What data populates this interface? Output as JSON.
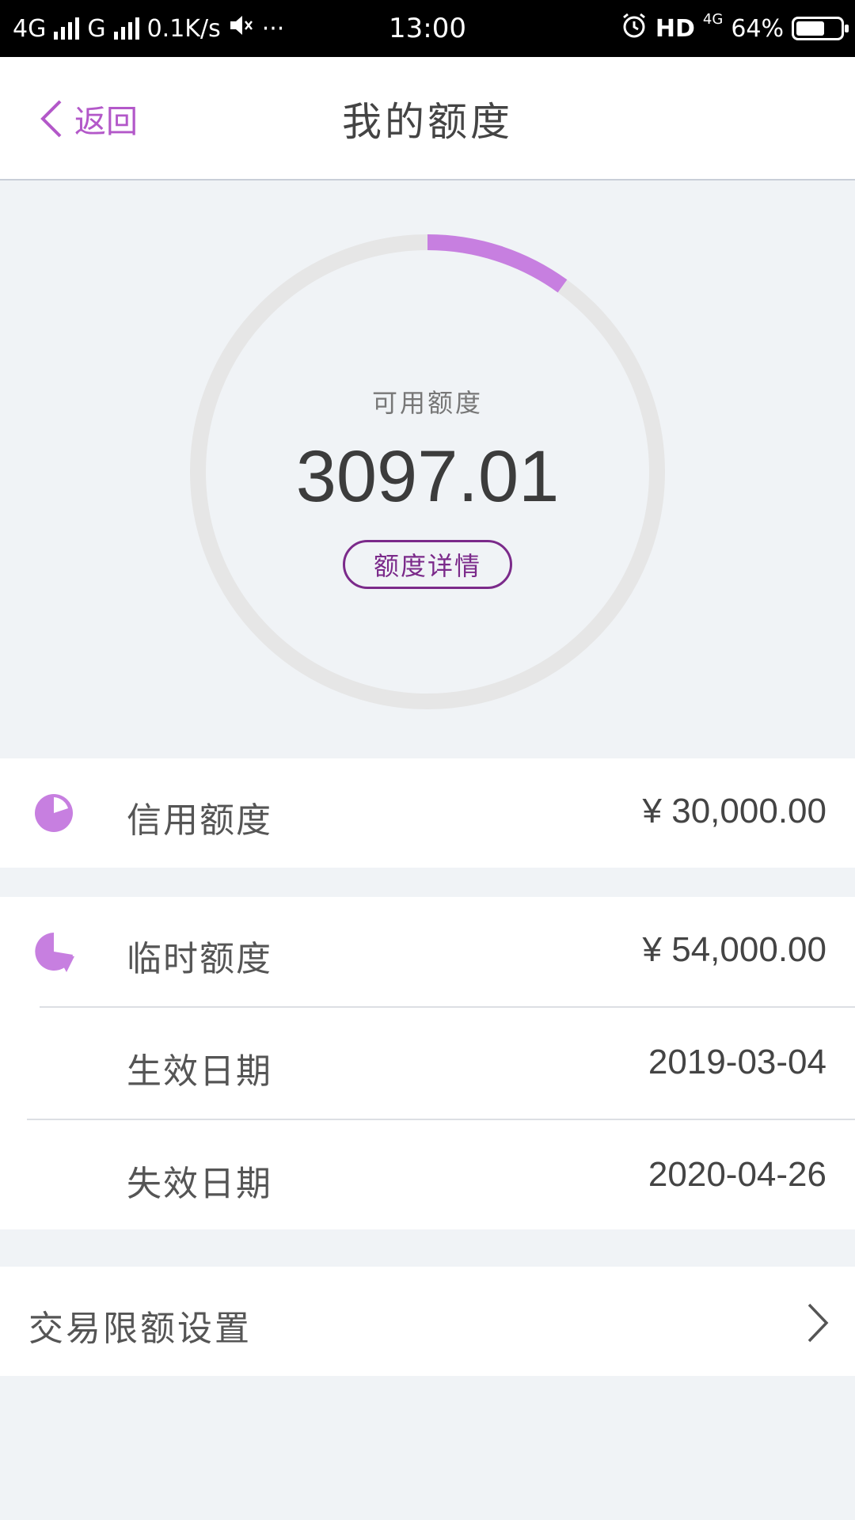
{
  "status_bar": {
    "network1": "4G",
    "network2": "G",
    "speed": "0.1K/s",
    "time": "13:00",
    "hd": "HD",
    "net_small": "4G",
    "battery": "64%",
    "battery_level": 0.64
  },
  "nav": {
    "back_label": "返回",
    "title": "我的额度"
  },
  "gauge": {
    "label": "可用额度",
    "value": "3097.01",
    "detail_button": "额度详情",
    "used_fraction": 0.1,
    "accent_color": "#c77fe0",
    "track_color": "#e6e6e6"
  },
  "credit": {
    "label": "信用额度",
    "value": "¥ 30,000.00",
    "icon": "pie-chart-icon"
  },
  "temp": {
    "label": "临时额度",
    "value": "¥ 54,000.00",
    "icon": "pie-chart-icon",
    "start_label": "生效日期",
    "start_value": "2019-03-04",
    "end_label": "失效日期",
    "end_value": "2020-04-26"
  },
  "limit_setting": {
    "label": "交易限额设置",
    "icon": "chevron-right-icon"
  }
}
